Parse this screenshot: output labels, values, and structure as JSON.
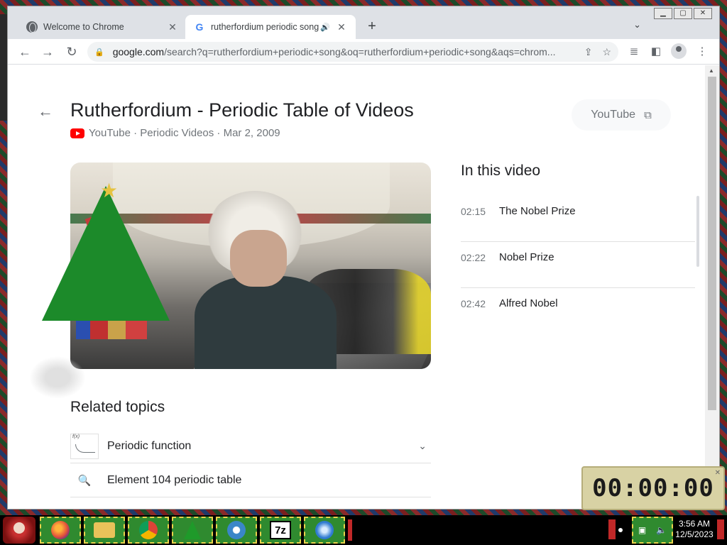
{
  "browser": {
    "tabs": [
      {
        "title": "Welcome to Chrome",
        "active": false
      },
      {
        "title": "rutherfordium periodic song",
        "active": true
      }
    ],
    "url_host": "google.com",
    "url_path": "/search?q=rutherfordium+periodic+song&oq=rutherfordium+periodic+song&aqs=chrom..."
  },
  "video": {
    "title": "Rutherfordium - Periodic Table of Videos",
    "source": "YouTube",
    "channel": "Periodic Videos",
    "date": "Mar 2, 2009",
    "separator": " · ",
    "chip_label": "YouTube"
  },
  "chapters": {
    "heading": "In this video",
    "items": [
      {
        "time": "02:15",
        "title": "The Nobel Prize"
      },
      {
        "time": "02:22",
        "title": "Nobel Prize"
      },
      {
        "time": "02:42",
        "title": "Alfred Nobel"
      }
    ]
  },
  "related": {
    "heading": "Related topics",
    "items": [
      {
        "label": "Periodic function",
        "thumb_text": "f(x)"
      },
      {
        "label": "Element 104 periodic table"
      }
    ]
  },
  "timer": {
    "display": "00:00:00"
  },
  "taskbar": {
    "apps": [
      "firefox-icon",
      "folder-icon",
      "chrome-icon",
      "tree-icon",
      "thunderbird-icon",
      "7zip-icon",
      "radiation-icon"
    ],
    "sevenzip_label": "7z",
    "time": "3:56 AM",
    "date": "12/5/2023"
  }
}
